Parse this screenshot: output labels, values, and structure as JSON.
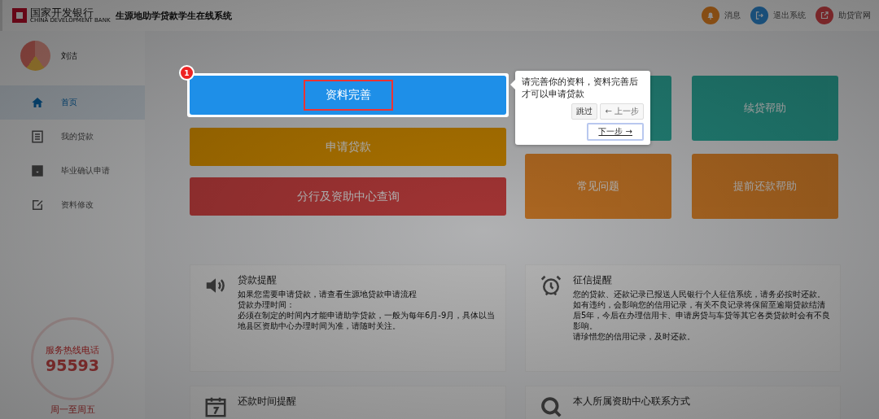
{
  "header": {
    "bank_name": "国家开发银行",
    "bank_name_en": "CHINA DEVELOPMENT BANK",
    "system_title": "生源地助学贷款学生在线系统",
    "actions": [
      {
        "label": "消息",
        "kind": "bell"
      },
      {
        "label": "退出系统",
        "kind": "logout"
      },
      {
        "label": "助贷官网",
        "kind": "external"
      }
    ]
  },
  "sidebar": {
    "user_name": "刘洁",
    "nav": [
      {
        "label": "首页",
        "selected": true
      },
      {
        "label": "我的贷款",
        "selected": false
      },
      {
        "label": "毕业确认申请",
        "selected": false
      },
      {
        "label": "资料修改",
        "selected": false
      }
    ],
    "hotline": {
      "label": "服务热线电话",
      "number": "95593",
      "hours": "周一至周五"
    }
  },
  "tiles_left": [
    {
      "label": "资料完善",
      "highlighted": true
    },
    {
      "label": "申请贷款",
      "highlighted": false
    },
    {
      "label": "分行及资助中心查询",
      "highlighted": false
    }
  ],
  "tiles_right": [
    {
      "kind": "covered"
    },
    {
      "kind": "labeled",
      "label": "续贷帮助"
    },
    {
      "kind": "labeled",
      "label": "常见问题"
    },
    {
      "kind": "labeled",
      "label": "提前还款帮助"
    }
  ],
  "notices": [
    {
      "title": "贷款提醒",
      "lines": [
        "如果您需要申请贷款，请查看生源地贷款申请流程",
        "贷款办理时间：",
        "必须在制定的时间内才能申请助学贷款，一般为每年6月-9月，具体以当地县区资助中心办理时间为准，请随时关注。"
      ]
    },
    {
      "title": "征信提醒",
      "lines": [
        "您的贷款、还款记录已报送人民银行个人征信系统，请务必按时还款。如有违约，会影响您的信用记录，有关不良记录将保留至逾期贷款结清后5年，今后在办理信用卡、申请房贷与车贷等其它各类贷款时会有不良影响。",
        "请珍惜您的信用记录，及时还款。"
      ]
    },
    {
      "title": "还款时间提醒"
    },
    {
      "title": "本人所属资助中心联系方式"
    }
  ],
  "tour": {
    "step": "1",
    "text": "请完善你的资料，资料完善后才可以申请贷款",
    "skip": "跳过",
    "prev": "← 上一步",
    "prev_disabled": true,
    "next": "下一步 →"
  }
}
